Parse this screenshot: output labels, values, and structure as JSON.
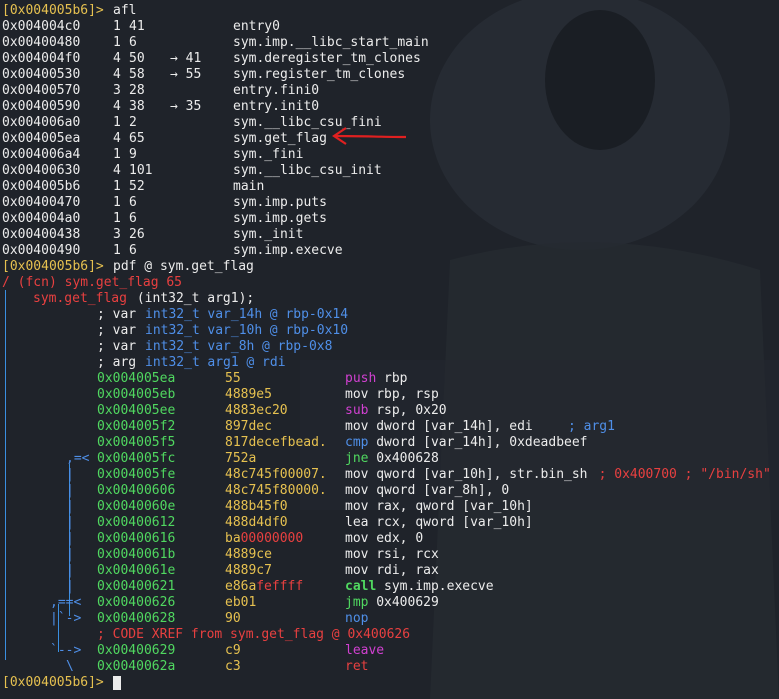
{
  "colors": {
    "background": "#1f232a",
    "prompt": "#e6c150",
    "address": "#ececec",
    "green": "#50d860",
    "blue": "#4f8fe8",
    "red": "#e84040",
    "magenta": "#d040d0",
    "arrow_annotation": "#e02020"
  },
  "session": {
    "prompt1": "[0x004005b6]>",
    "cmd1": "afl",
    "afl": [
      {
        "addr": "0x004004c0",
        "nbbs": "1",
        "size": "41",
        "xref": "",
        "name": "entry0"
      },
      {
        "addr": "0x00400480",
        "nbbs": "1",
        "size": "6",
        "xref": "",
        "name": "sym.imp.__libc_start_main"
      },
      {
        "addr": "0x004004f0",
        "nbbs": "4",
        "size": "50",
        "xref": "→ 41",
        "name": "sym.deregister_tm_clones"
      },
      {
        "addr": "0x00400530",
        "nbbs": "4",
        "size": "58",
        "xref": "→ 55",
        "name": "sym.register_tm_clones"
      },
      {
        "addr": "0x00400570",
        "nbbs": "3",
        "size": "28",
        "xref": "",
        "name": "entry.fini0"
      },
      {
        "addr": "0x00400590",
        "nbbs": "4",
        "size": "38",
        "xref": "→ 35",
        "name": "entry.init0"
      },
      {
        "addr": "0x004006a0",
        "nbbs": "1",
        "size": "2",
        "xref": "",
        "name": "sym.__libc_csu_fini"
      },
      {
        "addr": "0x004005ea",
        "nbbs": "4",
        "size": "65",
        "xref": "",
        "name": "sym.get_flag"
      },
      {
        "addr": "0x004006a4",
        "nbbs": "1",
        "size": "9",
        "xref": "",
        "name": "sym._fini"
      },
      {
        "addr": "0x00400630",
        "nbbs": "4",
        "size": "101",
        "xref": "",
        "name": "sym.__libc_csu_init"
      },
      {
        "addr": "0x004005b6",
        "nbbs": "1",
        "size": "52",
        "xref": "",
        "name": "main"
      },
      {
        "addr": "0x00400470",
        "nbbs": "1",
        "size": "6",
        "xref": "",
        "name": "sym.imp.puts"
      },
      {
        "addr": "0x004004a0",
        "nbbs": "1",
        "size": "6",
        "xref": "",
        "name": "sym.imp.gets"
      },
      {
        "addr": "0x00400438",
        "nbbs": "3",
        "size": "26",
        "xref": "",
        "name": "sym._init"
      },
      {
        "addr": "0x00400490",
        "nbbs": "1",
        "size": "6",
        "xref": "",
        "name": "sym.imp.execve"
      }
    ],
    "prompt2": "[0x004005b6]>",
    "cmd2": "pdf @ sym.get_flag",
    "fcn_line": "/ (fcn) sym.get_flag 65",
    "signature_name": "sym.get_flag",
    "signature_args": " (int32_t arg1);",
    "vars": [
      {
        "kind": "; var ",
        "type": "int32_t",
        "name": "var_14h",
        "loc": "@ rbp-0x14"
      },
      {
        "kind": "; var ",
        "type": "int32_t",
        "name": "var_10h",
        "loc": "@ rbp-0x10"
      },
      {
        "kind": "; var ",
        "type": "int32_t",
        "name": "var_8h",
        "loc": "@ rbp-0x8"
      },
      {
        "kind": "; arg ",
        "type": "int32_t",
        "name": "arg1",
        "loc": "@ rdi"
      }
    ],
    "disasm": [
      {
        "prefix": "",
        "addr": "0x004005ea",
        "bytes": "55",
        "bytes_extra": "",
        "mn": "push",
        "ops": "rbp",
        "comment": ""
      },
      {
        "prefix": "",
        "addr": "0x004005eb",
        "bytes": "4889e5",
        "bytes_extra": "",
        "mn": "mov",
        "ops": "rbp, rsp",
        "comment": ""
      },
      {
        "prefix": "",
        "addr": "0x004005ee",
        "bytes": "4883ec20",
        "bytes_extra": "",
        "mn": "sub",
        "ops": "rsp, 0x20",
        "comment": ""
      },
      {
        "prefix": "",
        "addr": "0x004005f2",
        "bytes": "897dec",
        "bytes_extra": "",
        "mn": "mov",
        "ops": "dword [var_14h], edi",
        "comment": "; arg1"
      },
      {
        "prefix": "",
        "addr": "0x004005f5",
        "bytes": "817decefbead.",
        "bytes_extra": "",
        "mn": "cmp",
        "ops": "dword [var_14h], 0xdeadbeef",
        "comment": ""
      },
      {
        "prefix": ",=<",
        "addr": "0x004005fc",
        "bytes": "752a",
        "bytes_extra": "",
        "mn": "jne",
        "ops": "0x400628",
        "comment": ""
      },
      {
        "prefix": "|",
        "addr": "0x004005fe",
        "bytes": "48c745f00007.",
        "bytes_extra": "",
        "mn": "mov",
        "ops": "qword [var_10h], str.bin_sh",
        "comment": "; 0x400700 ; \"/bin/sh\""
      },
      {
        "prefix": "|",
        "addr": "0x00400606",
        "bytes": "48c745f80000.",
        "bytes_extra": "",
        "mn": "mov",
        "ops": "qword [var_8h], 0",
        "comment": ""
      },
      {
        "prefix": "|",
        "addr": "0x0040060e",
        "bytes": "488b45f0",
        "bytes_extra": "",
        "mn": "mov",
        "ops": "rax, qword [var_10h]",
        "comment": ""
      },
      {
        "prefix": "|",
        "addr": "0x00400612",
        "bytes": "488d4df0",
        "bytes_extra": "",
        "mn": "lea",
        "ops": "rcx, qword [var_10h]",
        "comment": ""
      },
      {
        "prefix": "|",
        "addr": "0x00400616",
        "bytes": "ba",
        "bytes_extra": "00000000",
        "mn": "mov",
        "ops": "edx, 0",
        "comment": ""
      },
      {
        "prefix": "|",
        "addr": "0x0040061b",
        "bytes": "4889ce",
        "bytes_extra": "",
        "mn": "mov",
        "ops": "rsi, rcx",
        "comment": ""
      },
      {
        "prefix": "|",
        "addr": "0x0040061e",
        "bytes": "4889c7",
        "bytes_extra": "",
        "mn": "mov",
        "ops": "rdi, rax",
        "comment": ""
      },
      {
        "prefix": "|",
        "addr": "0x00400621",
        "bytes": "e86a",
        "bytes_extra": "feffff",
        "mn": "call",
        "ops": "sym.imp.execve",
        "comment": ""
      },
      {
        "prefix": ",==<",
        "addr": "0x00400626",
        "bytes": "eb01",
        "bytes_extra": "",
        "mn": "jmp",
        "ops": "0x400629",
        "comment": ""
      },
      {
        "prefix": "|`->",
        "addr": "0x00400628",
        "bytes": "90",
        "bytes_extra": "",
        "mn": "nop",
        "ops": "",
        "comment": ""
      }
    ],
    "xref": "; CODE XREF from sym.get_flag @ 0x400626",
    "disasm_tail": [
      {
        "prefix": "`-->",
        "addr": "0x00400629",
        "bytes": "c9",
        "bytes_extra": "",
        "mn": "leave",
        "ops": "",
        "comment": ""
      },
      {
        "prefix": "\\",
        "addr": "0x0040062a",
        "bytes": "c3",
        "bytes_extra": "",
        "mn": "ret",
        "ops": "",
        "comment": ""
      }
    ],
    "prompt3": "[0x004005b6]>"
  }
}
